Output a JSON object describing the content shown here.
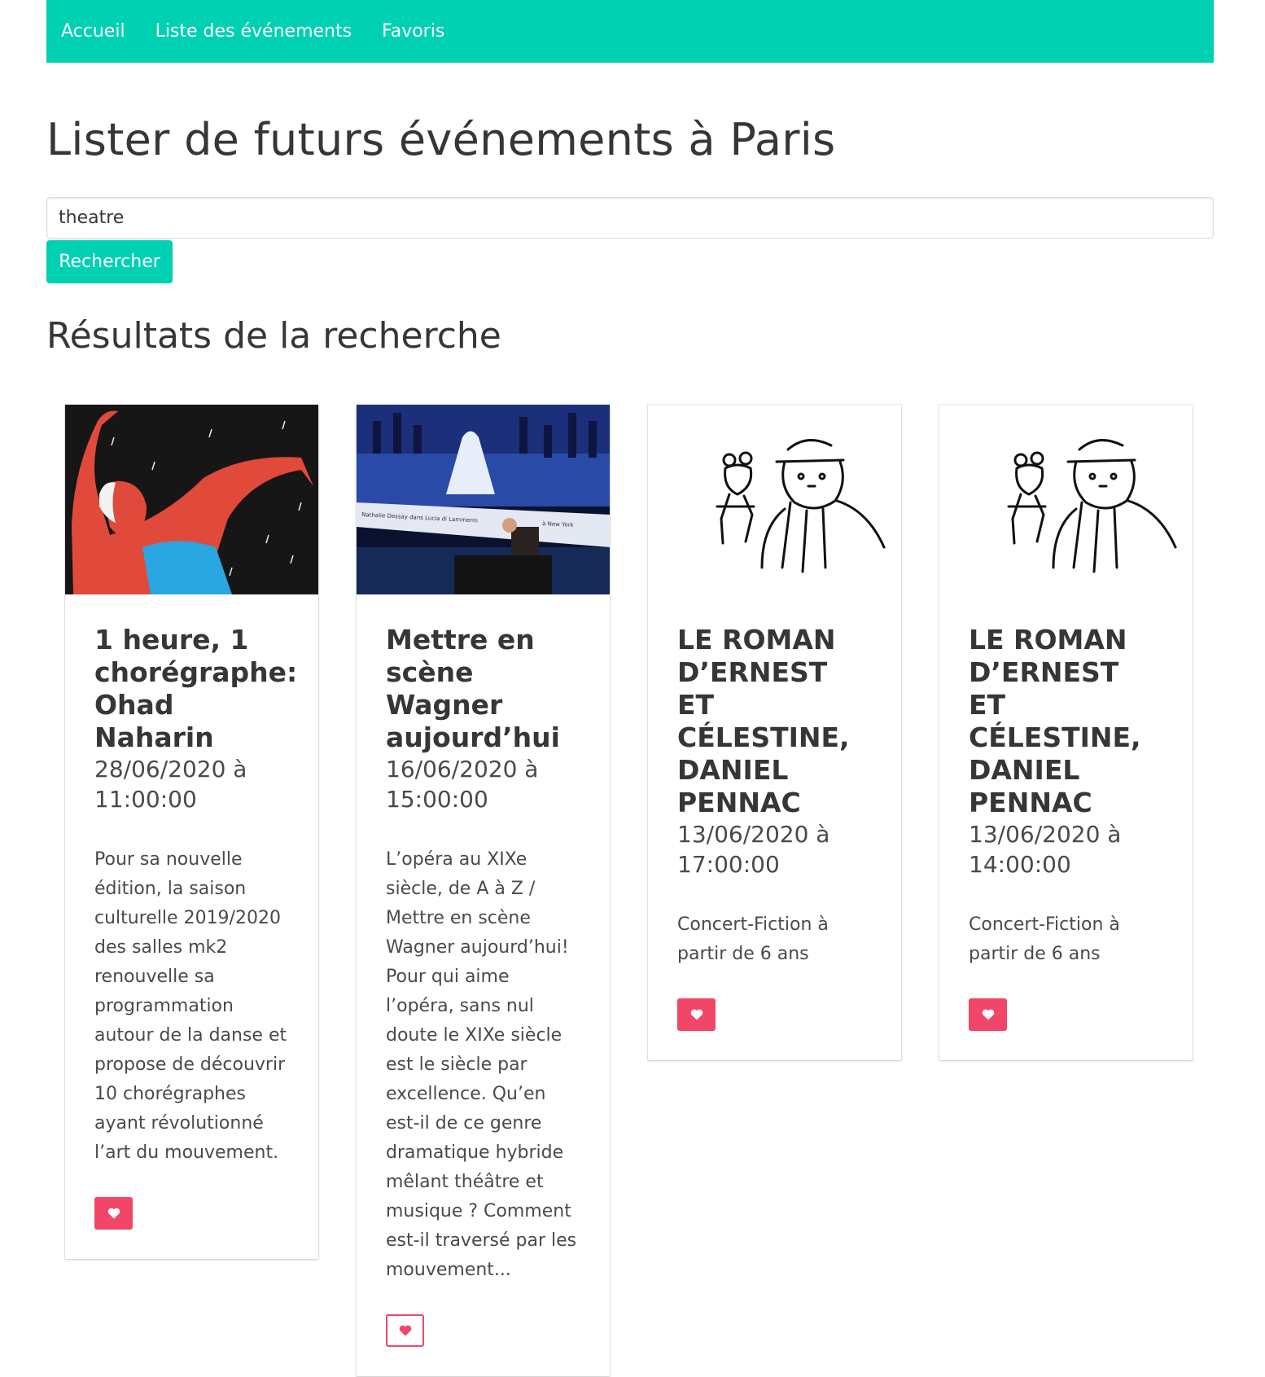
{
  "nav": {
    "items": [
      {
        "label": "Accueil"
      },
      {
        "label": "Liste des événements"
      },
      {
        "label": "Favoris"
      }
    ]
  },
  "page": {
    "title": "Lister de futurs événements à Paris"
  },
  "search": {
    "value": "theatre",
    "button_label": "Rechercher"
  },
  "results": {
    "title": "Résultats de la recherche",
    "cards": [
      {
        "title": "1 heure, 1 chorégraphe: Ohad Naharin",
        "date": "28/06/2020 à 11:00:00",
        "description": "Pour sa nouvelle édition, la saison culturelle 2019/2020 des salles mk2 renouvelle sa programmation autour de la danse et propose de découvrir 10 chorégraphes ayant révolutionné l’art du mouvement.",
        "image_icon": "dancer-illustration",
        "favorite": true
      },
      {
        "title": "Mettre en scène Wagner aujourd’hui",
        "date": "16/06/2020 à 15:00:00",
        "description": "L’opéra au XIXe siècle, de A à Z / Mettre en scène Wagner aujourd’hui! Pour qui aime l’opéra, sans nul doute le XIXe siècle est le siècle par excellence. Qu’en est-il de ce genre dramatique hybride mêlant théâtre et musique ? Comment est-il traversé par les mouvement...",
        "image_icon": "opera-stage-photo",
        "image_caption_left": "Nathalie Dessay dans Lucia di Lammerm",
        "image_caption_right": "à New York",
        "favorite": false
      },
      {
        "title": "LE ROMAN D’ERNEST ET CÉLESTINE, DANIEL PENNAC",
        "date": "13/06/2020 à 17:00:00",
        "description": "Concert-Fiction à partir de 6 ans",
        "image_icon": "ernest-celestine-sketch",
        "favorite": true
      },
      {
        "title": "LE ROMAN D’ERNEST ET CÉLESTINE, DANIEL PENNAC",
        "date": "13/06/2020 à 14:00:00",
        "description": "Concert-Fiction à partir de 6 ans",
        "image_icon": "ernest-celestine-sketch",
        "favorite": true
      }
    ]
  },
  "colors": {
    "primary": "#00d1b2",
    "danger": "#f14668",
    "text": "#363636"
  }
}
